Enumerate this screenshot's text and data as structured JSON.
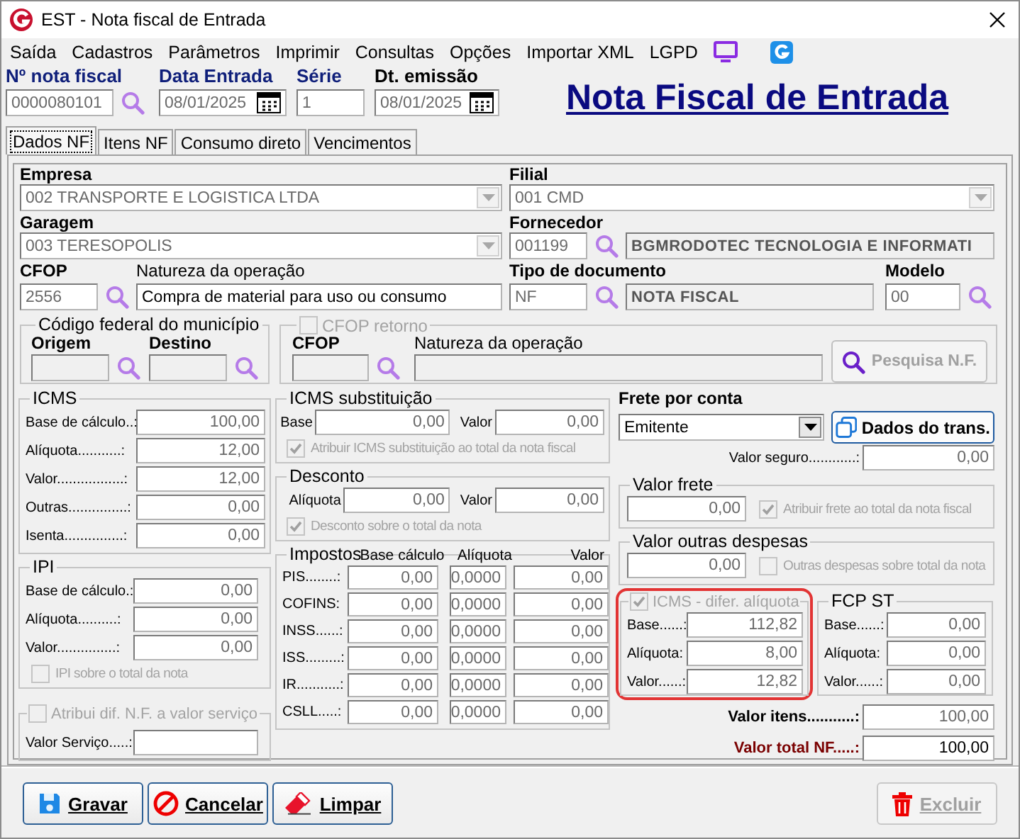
{
  "window": {
    "title": "EST - Nota fiscal de Entrada"
  },
  "menu": [
    "Saída",
    "Cadastros",
    "Parâmetros",
    "Imprimir",
    "Consultas",
    "Opções",
    "Importar XML",
    "LGPD"
  ],
  "header": [
    {
      "label": "Nº nota fiscal",
      "value": "0000080101",
      "kind": "search",
      "required": true
    },
    {
      "label": "Data Entrada",
      "value": "08/01/2025",
      "kind": "date",
      "required": true
    },
    {
      "label": "Série",
      "value": "1",
      "kind": "plain",
      "required": true
    },
    {
      "label": "Dt. emissão",
      "value": "08/01/2025",
      "kind": "date",
      "required": false
    }
  ],
  "page_title": "Nota Fiscal de Entrada",
  "tabs": [
    {
      "label": "Dados NF",
      "selected": true
    },
    {
      "label": "Itens NF",
      "selected": false
    },
    {
      "label": "Consumo direto",
      "selected": false
    },
    {
      "label": "Vencimentos",
      "selected": false
    }
  ],
  "empresa": {
    "label": "Empresa",
    "value": "002  TRANSPORTE E LOGISTICA LTDA",
    "disabled": true
  },
  "filial": {
    "label": "Filial",
    "value": "001 CMD",
    "disabled": true
  },
  "garagem": {
    "label": "Garagem",
    "value": "003 TERESOPOLIS",
    "disabled": true
  },
  "fornecedor": {
    "label": "Fornecedor",
    "code": "001199",
    "name": "BGMRODOTEC TECNOLOGIA E INFORMATI"
  },
  "cfop": {
    "label": "CFOP",
    "code": "2556",
    "nature_label": "Natureza da operação",
    "nature": "Compra de material para uso ou consumo"
  },
  "tipo_documento": {
    "label": "Tipo de documento",
    "code": "NF",
    "name": "NOTA FISCAL"
  },
  "modelo": {
    "label": "Modelo",
    "value": "00"
  },
  "codigo_federal": {
    "title": "Código federal do município",
    "origem_label": "Origem",
    "destino_label": "Destino"
  },
  "cfop_retorno": {
    "title": "CFOP retorno",
    "checked": false,
    "disabled": true,
    "cfop_label": "CFOP",
    "nature_label": "Natureza da operação",
    "search_button": {
      "label": "Pesquisa N.F.",
      "disabled": true
    }
  },
  "icms": {
    "title": "ICMS",
    "rows": [
      {
        "label": "Base de cálculo..:",
        "value": "100,00"
      },
      {
        "label": "Alíquota...........:",
        "value": "12,00"
      },
      {
        "label": "Valor.................:",
        "value": "12,00"
      },
      {
        "label": "Outras...............:",
        "value": "0,00"
      },
      {
        "label": "Isenta...............:",
        "value": "0,00"
      }
    ]
  },
  "ipi": {
    "title": "IPI",
    "rows": [
      {
        "label": "Base de cálculo.:",
        "value": "0,00"
      },
      {
        "label": "Alíquota..........:",
        "value": "0,00"
      },
      {
        "label": "Valor...............:",
        "value": "0,00"
      }
    ],
    "checkbox": {
      "label": "IPI sobre o total da nota",
      "checked": false,
      "disabled": true
    }
  },
  "atribui_dif": {
    "title": "Atribui dif. N.F. a valor serviço",
    "checked": false,
    "disabled": true,
    "field_label": "Valor Serviço.....:"
  },
  "icms_substituicao": {
    "title": "ICMS substituição",
    "base_label": "Base",
    "base": "0,00",
    "valor_label": "Valor",
    "valor": "0,00",
    "checkbox": {
      "label": "Atribuir ICMS substituição ao total da nota fiscal",
      "checked": true,
      "disabled": true
    }
  },
  "desconto": {
    "title": "Desconto",
    "aliquota_label": "Alíquota",
    "aliquota": "0,00",
    "valor_label": "Valor",
    "valor": "0,00",
    "checkbox": {
      "label": "Desconto sobre o total da nota",
      "checked": true,
      "disabled": true
    }
  },
  "impostos": {
    "title": "Impostos",
    "columns": [
      "Base cálculo",
      "Alíquota",
      "Valor"
    ],
    "rows": [
      {
        "label": "PIS........:",
        "values": [
          "0,00",
          "0,0000",
          "0,00"
        ]
      },
      {
        "label": "COFINS:",
        "values": [
          "0,00",
          "0,0000",
          "0,00"
        ]
      },
      {
        "label": "INSS......:",
        "values": [
          "0,00",
          "0,0000",
          "0,00"
        ]
      },
      {
        "label": "ISS.........:",
        "values": [
          "0,00",
          "0,0000",
          "0,00"
        ]
      },
      {
        "label": "IR...........:",
        "values": [
          "0,00",
          "0,0000",
          "0,00"
        ]
      },
      {
        "label": "CSLL.....:",
        "values": [
          "0,00",
          "0,0000",
          "0,00"
        ]
      }
    ]
  },
  "frete_por_conta": {
    "label": "Frete por conta",
    "value": "Emitente",
    "disabled": false
  },
  "transport_button": {
    "label": "Dados do trans."
  },
  "valor_seguro": {
    "label": "Valor seguro............:",
    "value": "0,00"
  },
  "valor_frete": {
    "title": "Valor frete",
    "value": "0,00",
    "checkbox": {
      "label": "Atribuir frete ao total da nota fiscal",
      "checked": true,
      "disabled": true
    }
  },
  "outras_despesas": {
    "title": "Valor outras despesas",
    "value": "0,00",
    "checkbox": {
      "label": "Outras despesas sobre total da nota",
      "checked": false,
      "disabled": true
    }
  },
  "icms_difer": {
    "title": "ICMS - difer. alíquota",
    "checked": true,
    "disabled": true,
    "highlighted": true,
    "rows": [
      {
        "label": "Base......:",
        "value": "112,82"
      },
      {
        "label": "Alíquota:",
        "value": "8,00"
      },
      {
        "label": "Valor......:",
        "value": "12,82"
      }
    ]
  },
  "fcp_st": {
    "title": "FCP ST",
    "rows": [
      {
        "label": "Base......:",
        "value": "0,00"
      },
      {
        "label": "Alíquota:",
        "value": "0,00"
      },
      {
        "label": "Valor......:",
        "value": "0,00"
      }
    ]
  },
  "valor_itens": {
    "label": "Valor itens...........:",
    "value": "100,00"
  },
  "valor_total": {
    "label": "Valor total NF.....:",
    "value": "100,00"
  },
  "buttons": [
    {
      "label": "Gravar",
      "kind": "save",
      "disabled": false
    },
    {
      "label": "Cancelar",
      "kind": "cancel",
      "disabled": false
    },
    {
      "label": "Limpar",
      "kind": "clear",
      "disabled": false
    },
    {
      "label": "Excluir",
      "kind": "delete",
      "disabled": true
    }
  ]
}
